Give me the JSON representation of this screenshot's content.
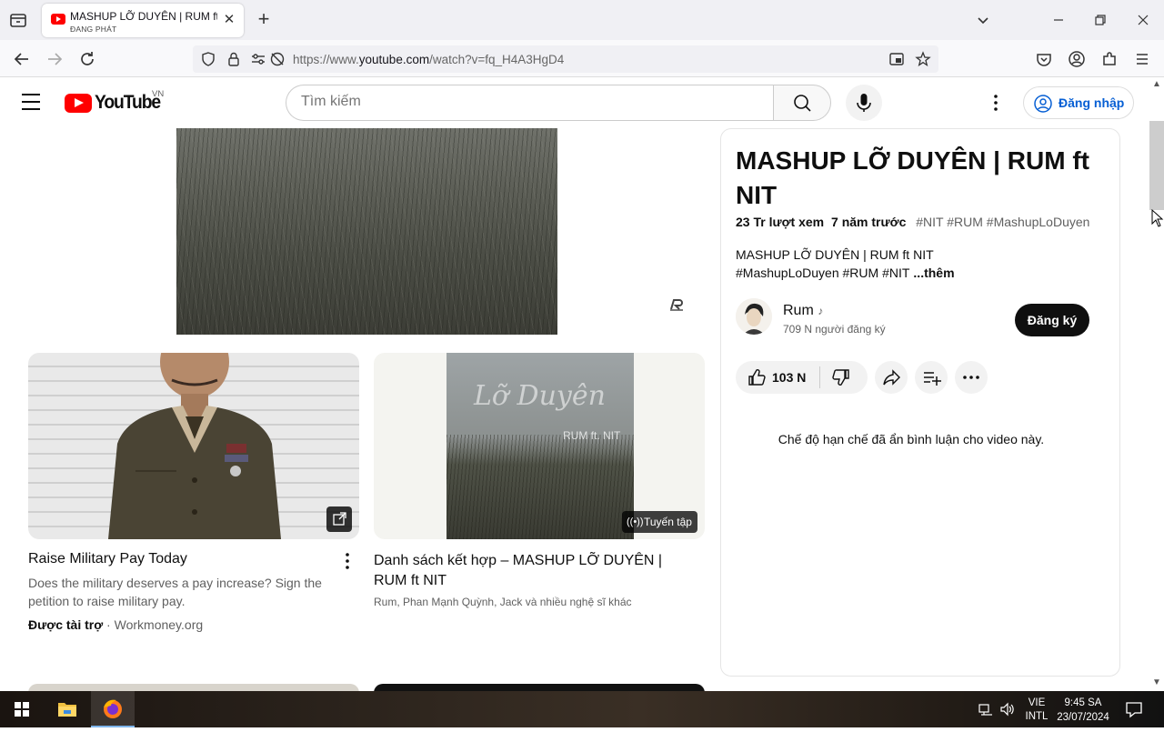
{
  "browser": {
    "tab": {
      "title": "MASHUP LỠ DUYÊN | RUM ft NIT",
      "subtitle": "ĐANG PHÁT"
    },
    "url": {
      "prefix": "https://www.",
      "domain": "youtube.com",
      "path": "/watch?v=fq_H4A3HgD4"
    }
  },
  "youtube": {
    "logo_text": "YouTube",
    "country_code": "VN",
    "search_placeholder": "Tìm kiếm",
    "signin_label": "Đăng nhập"
  },
  "ad": {
    "title": "Raise Military Pay Today",
    "description": "Does the military deserves a pay increase? Sign the petition to raise military pay.",
    "sponsored_label": "Được tài trợ",
    "separator": " · ",
    "domain": "Workmoney.org"
  },
  "playlist": {
    "badge": "Tuyến tập",
    "title": "Danh sách kết hợp – MASHUP LỠ DUYÊN | RUM ft NIT",
    "subtitle": "Rum, Phan Mạnh Quỳnh, Jack và nhiều nghệ sĩ khác",
    "cover_script": "Lỡ Duyên",
    "cover_artist": "RUM ft. NIT"
  },
  "video": {
    "title": "MASHUP LỠ DUYÊN | RUM ft NIT",
    "views": "23 Tr lượt xem",
    "age": "7 năm trước",
    "tags": "#NIT #RUM #MashupLoDuyen",
    "desc_line1": "MASHUP LỠ DUYÊN | RUM ft NIT",
    "desc_line2": "#MashupLoDuyen #RUM #NIT",
    "more_label": "...thêm",
    "channel_name": "Rum",
    "channel_subs": "709 N người đăng ký",
    "subscribe_label": "Đăng ký",
    "like_count": "103 N",
    "comments_off": "Chế độ hạn chế đã ẩn bình luận cho video này."
  },
  "taskbar": {
    "lang_line1": "VIE",
    "lang_line2": "INTL",
    "time": "9:45 SA",
    "date": "23/07/2024"
  },
  "icons": {
    "tab_list": "tab-list-icon",
    "back": "back-arrow-icon",
    "forward": "forward-arrow-icon",
    "reload": "reload-icon",
    "shield": "tracking-protection-icon",
    "lock": "lock-icon",
    "permissions": "permissions-icon",
    "autoplay_blocked": "autoplay-blocked-icon",
    "pip": "picture-in-picture-icon",
    "bookmark": "star-icon",
    "pocket": "pocket-icon",
    "account": "account-icon",
    "extensions": "extensions-icon",
    "menu": "hamburger-menu-icon"
  },
  "colors": {
    "yt_red": "#ff0000",
    "link_blue": "#065fd4",
    "subscribe_bg": "#0f0f0f"
  }
}
